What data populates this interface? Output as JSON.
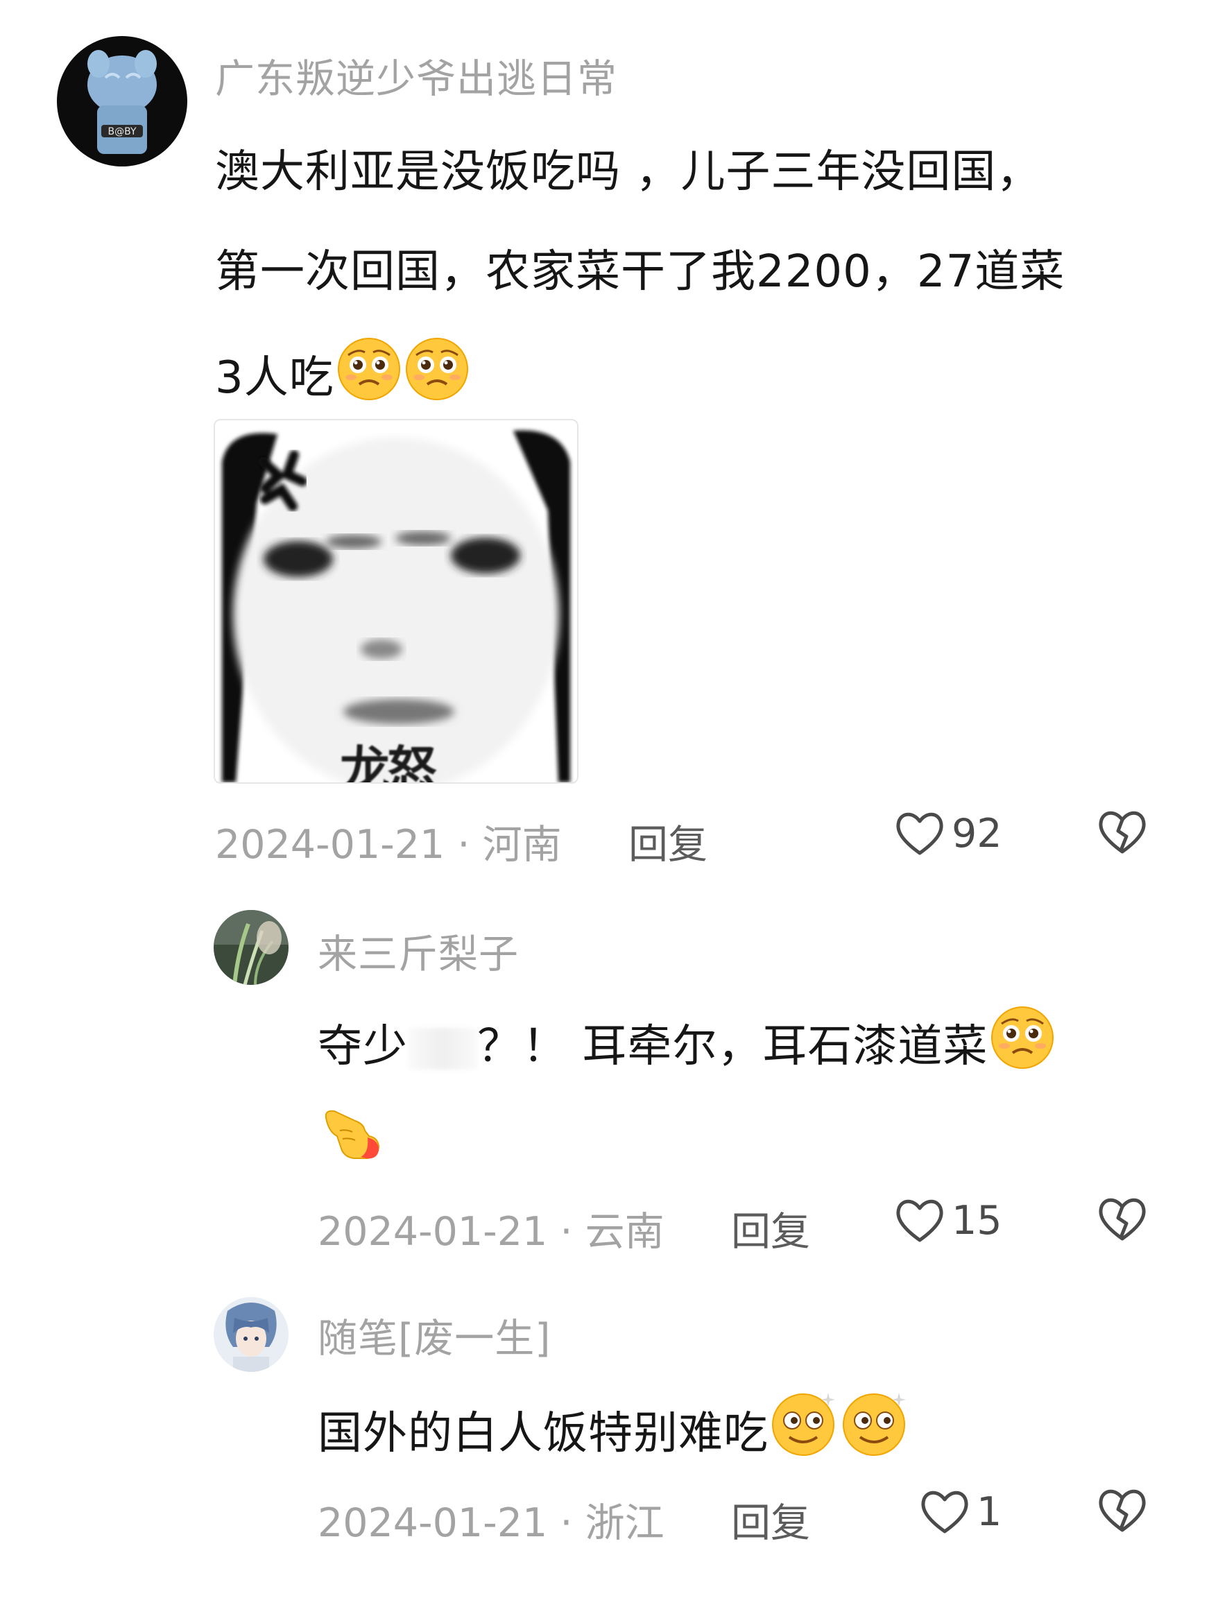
{
  "comments": [
    {
      "username": "广东叛逆少爷出逃日常",
      "text_line1": "澳大利亚是没饭吃吗 ，儿子三年没回国，",
      "text_line2": "第一次回国，农家菜干了我2200，27道菜",
      "text_line3": "3人吃",
      "emojis": [
        "pleading-face-icon",
        "pleading-face-icon"
      ],
      "sticker_caption": "龙怒",
      "date": "2024-01-21",
      "location": "河南",
      "reply_label": "回复",
      "likes": "92",
      "avatar_text": "B@BY"
    },
    {
      "username": "来三斤梨子",
      "text_line1a": "夺少",
      "text_line1b": "？！ 耳牵尔，耳石漆道菜",
      "date": "2024-01-21",
      "location": "云南",
      "reply_label": "回复",
      "likes": "15"
    },
    {
      "username": "随笔[废一生]",
      "text_line1": "国外的白人饭特别难吃",
      "date": "2024-01-21",
      "location": "浙江",
      "reply_label": "回复",
      "likes": "1"
    }
  ],
  "separator": " · ",
  "colors": {
    "meta_gray": "#a3a3a3",
    "text_dark": "#161616",
    "emoji_yellow": "#ffc83d"
  }
}
